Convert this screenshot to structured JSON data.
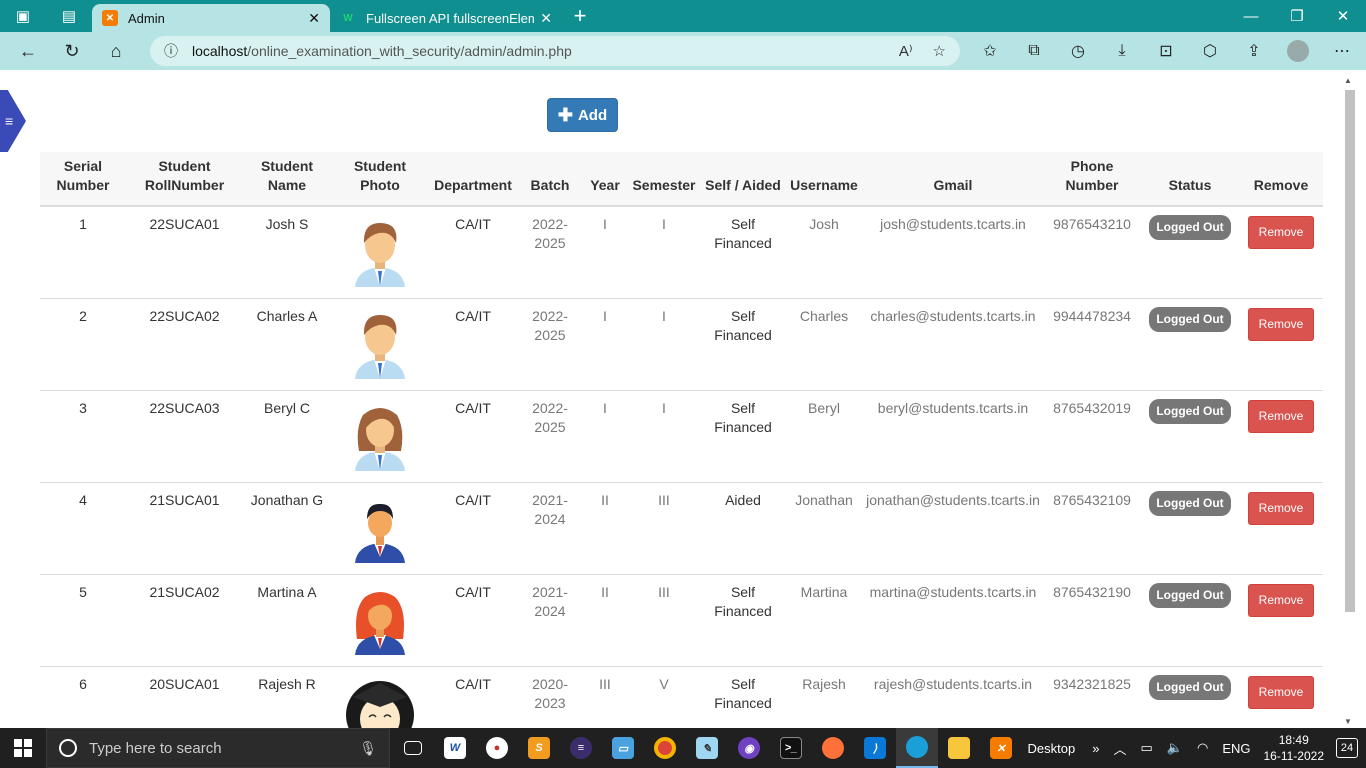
{
  "browser": {
    "tabs": [
      {
        "title": "Admin",
        "active": true
      },
      {
        "title": "Fullscreen API fullscreenElement",
        "active": false
      }
    ],
    "url_host": "localhost",
    "url_path": "/online_examination_with_security/admin/admin.php"
  },
  "page": {
    "add_label": "Add",
    "headers": {
      "serial": "Serial Number",
      "roll": "Student RollNumber",
      "name": "Student Name",
      "photo": "Student Photo",
      "department": "Department",
      "batch": "Batch",
      "year": "Year",
      "semester": "Semester",
      "aided": "Self / Aided",
      "username": "Username",
      "gmail": "Gmail",
      "phone": "Phone Number",
      "status": "Status",
      "remove": "Remove"
    },
    "status_label": "Logged Out",
    "remove_label": "Remove",
    "students": [
      {
        "serial": "1",
        "roll": "22SUCA01",
        "name": "Josh S",
        "avatar": "male-student-icon",
        "department": "CA/IT",
        "batch": "2022-2025",
        "year": "I",
        "semester": "I",
        "aided": "Self Financed",
        "username": "Josh",
        "gmail": "josh@students.tcarts.in",
        "phone": "9876543210"
      },
      {
        "serial": "2",
        "roll": "22SUCA02",
        "name": "Charles A",
        "avatar": "male-student-icon",
        "department": "CA/IT",
        "batch": "2022-2025",
        "year": "I",
        "semester": "I",
        "aided": "Self Financed",
        "username": "Charles",
        "gmail": "charles@students.tcarts.in",
        "phone": "9944478234"
      },
      {
        "serial": "3",
        "roll": "22SUCA03",
        "name": "Beryl C",
        "avatar": "female-student-icon",
        "department": "CA/IT",
        "batch": "2022-2025",
        "year": "I",
        "semester": "I",
        "aided": "Self Financed",
        "username": "Beryl",
        "gmail": "beryl@students.tcarts.in",
        "phone": "8765432019"
      },
      {
        "serial": "4",
        "roll": "21SUCA01",
        "name": "Jonathan G",
        "avatar": "businessman-icon",
        "department": "CA/IT",
        "batch": "2021-2024",
        "year": "II",
        "semester": "III",
        "aided": "Aided",
        "username": "Jonathan",
        "gmail": "jonathan@students.tcarts.in",
        "phone": "8765432109"
      },
      {
        "serial": "5",
        "roll": "21SUCA02",
        "name": "Martina A",
        "avatar": "redhead-woman-icon",
        "department": "CA/IT",
        "batch": "2021-2024",
        "year": "II",
        "semester": "III",
        "aided": "Self Financed",
        "username": "Martina",
        "gmail": "martina@students.tcarts.in",
        "phone": "8765432190"
      },
      {
        "serial": "6",
        "roll": "20SUCA01",
        "name": "Rajesh R",
        "avatar": "graduate-icon",
        "department": "CA/IT",
        "batch": "2020-2023",
        "year": "III",
        "semester": "V",
        "aided": "Self Financed",
        "username": "Rajesh",
        "gmail": "rajesh@students.tcarts.in",
        "phone": "9342321825"
      }
    ]
  },
  "taskbar": {
    "search_placeholder": "Type here to search",
    "desktop_label": "Desktop",
    "language": "ENG",
    "time": "18:49",
    "date": "16-11-2022",
    "notifications": "24"
  },
  "colors": {
    "browser_frame": "#0f8f8f",
    "address_bar": "#b6e3e3",
    "add_button": "#337ab7",
    "remove_button": "#d9534f",
    "status_badge": "#777777"
  }
}
